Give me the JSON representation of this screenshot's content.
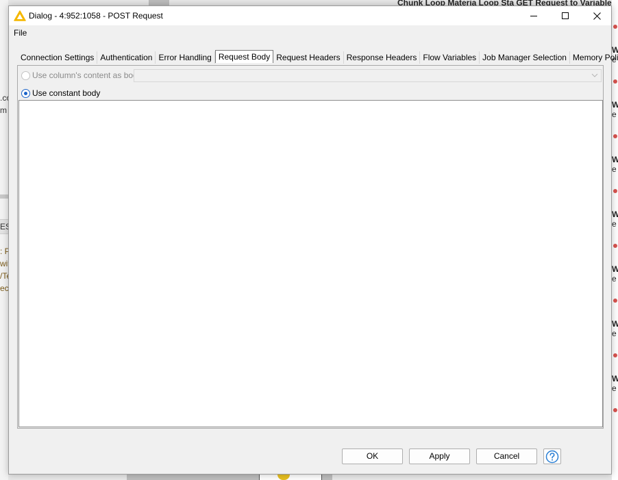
{
  "dialog": {
    "title": "Dialog - 4:952:1058 - POST Request",
    "menu": {
      "file": "File"
    },
    "tabs": [
      {
        "label": "Connection Settings"
      },
      {
        "label": "Authentication"
      },
      {
        "label": "Error Handling"
      },
      {
        "label": "Request Body",
        "active": true
      },
      {
        "label": "Request Headers"
      },
      {
        "label": "Response Headers"
      },
      {
        "label": "Flow Variables"
      },
      {
        "label": "Job Manager Selection"
      },
      {
        "label": "Memory Policy"
      }
    ],
    "request_body": {
      "option_column": "Use column's content as body",
      "option_constant": "Use constant body",
      "selected_option": "Use constant body",
      "column_select_value": "",
      "constant_body_text": ""
    },
    "buttons": {
      "ok": "OK",
      "apply": "Apply",
      "cancel": "Cancel"
    }
  },
  "background": {
    "top_fragment": "Chunk Loop  Materia Loop Sta GET Request    to Variable",
    "left_fragments": [
      ".co",
      "m",
      "EST",
      ": P",
      "wit",
      "/Te",
      "ect"
    ],
    "right_fragments": [
      {
        "bold": "W",
        "normal": "e"
      },
      {
        "bold": "W",
        "normal": "e"
      },
      {
        "bold": "W",
        "normal": "e"
      },
      {
        "bold": "W",
        "normal": "e"
      },
      {
        "bold": "W",
        "normal": "e"
      },
      {
        "bold": "W",
        "normal": "e"
      },
      {
        "bold": "W",
        "normal": "e"
      }
    ]
  },
  "colors": {
    "accent": "#1a63c8",
    "warning_icon": "#f5b800",
    "help_icon": "#2a7fd4",
    "port_dot": "#d9534f"
  }
}
